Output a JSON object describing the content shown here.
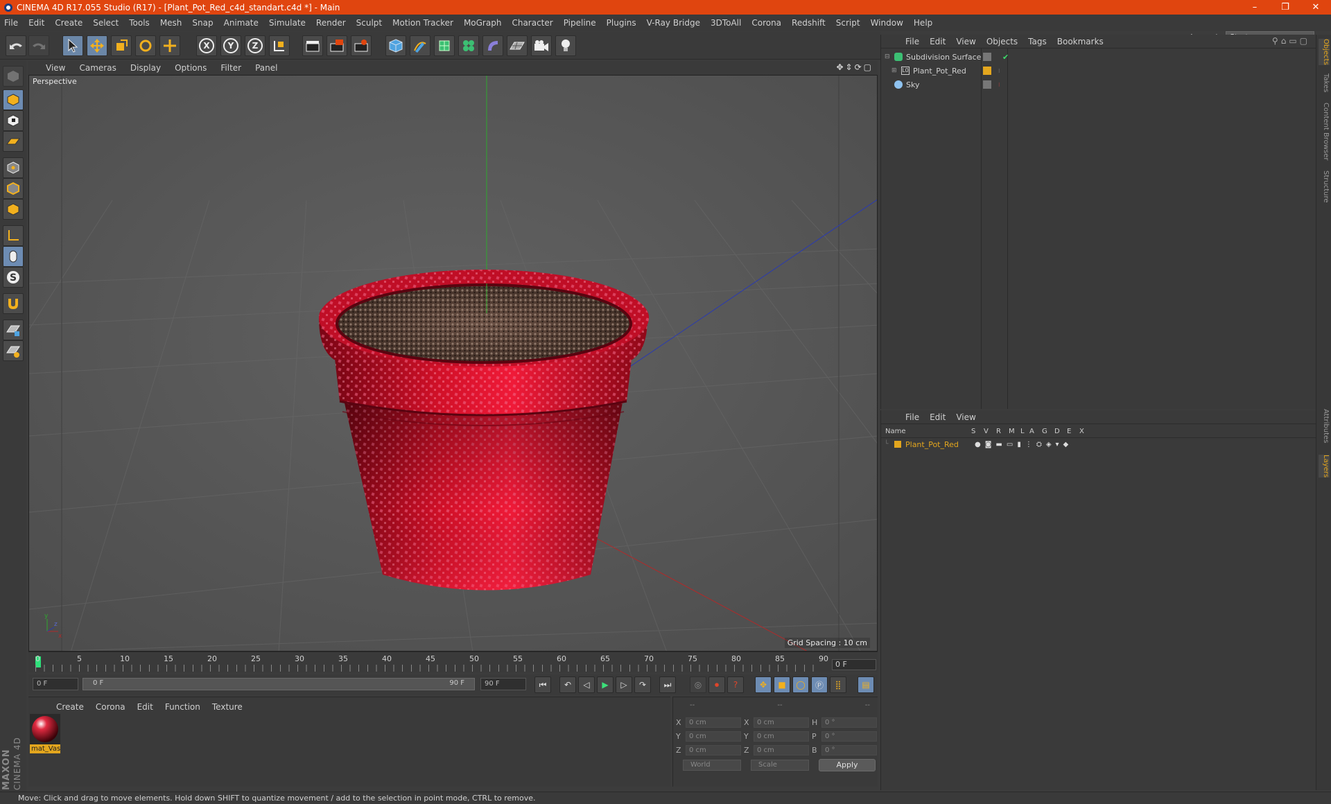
{
  "window": {
    "title": "CINEMA 4D R17.055 Studio (R17) - [Plant_Pot_Red_c4d_standart.c4d *] - Main",
    "controls": [
      "–",
      "❐",
      "✕"
    ]
  },
  "menubar": [
    "File",
    "Edit",
    "Create",
    "Select",
    "Tools",
    "Mesh",
    "Snap",
    "Animate",
    "Simulate",
    "Render",
    "Sculpt",
    "Motion Tracker",
    "MoGraph",
    "Character",
    "Pipeline",
    "Plugins",
    "V-Ray Bridge",
    "3DToAll",
    "Corona",
    "Redshift",
    "Script",
    "Window",
    "Help"
  ],
  "layout": {
    "label": "Layout:",
    "value": "Startup"
  },
  "toolbar": {
    "axis_x": "X",
    "axis_y": "Y",
    "axis_z": "Z"
  },
  "viewport": {
    "menu": [
      "View",
      "Cameras",
      "Display",
      "Options",
      "Filter",
      "Panel"
    ],
    "label": "Perspective",
    "grid_spacing": "Grid Spacing : 10 cm"
  },
  "timeline": {
    "ticks": [
      "0",
      "5",
      "10",
      "15",
      "20",
      "25",
      "30",
      "35",
      "40",
      "45",
      "50",
      "55",
      "60",
      "65",
      "70",
      "75",
      "80",
      "85",
      "90"
    ],
    "current_frame": "0 F"
  },
  "transport": {
    "start": "0 F",
    "range_start": "0 F",
    "range_end": "90 F",
    "end": "90 F"
  },
  "materials": {
    "menu": [
      "Create",
      "Corona",
      "Edit",
      "Function",
      "Texture"
    ],
    "items": [
      {
        "name": "mat_Vas"
      }
    ]
  },
  "coordinates": {
    "header": [
      "--",
      "--",
      "--"
    ],
    "rows": [
      {
        "l1": "X",
        "v1": "0 cm",
        "l2": "X",
        "v2": "0 cm",
        "l3": "H",
        "v3": "0 °"
      },
      {
        "l1": "Y",
        "v1": "0 cm",
        "l2": "Y",
        "v2": "0 cm",
        "l3": "P",
        "v3": "0 °"
      },
      {
        "l1": "Z",
        "v1": "0 cm",
        "l2": "Z",
        "v2": "0 cm",
        "l3": "B",
        "v3": "0 °"
      }
    ],
    "world": "World",
    "scale": "Scale",
    "apply": "Apply"
  },
  "status": "Move: Click and drag to move elements. Hold down SHIFT to quantize movement / add to the selection in point mode, CTRL to remove.",
  "objects_panel": {
    "menu": [
      "File",
      "Edit",
      "View",
      "Objects",
      "Tags",
      "Bookmarks"
    ],
    "objects": [
      {
        "name": "Subdivision Surface"
      },
      {
        "name": "Plant_Pot_Red"
      },
      {
        "name": "Sky"
      }
    ]
  },
  "layers_panel": {
    "menu": [
      "File",
      "Edit",
      "View"
    ],
    "columns": [
      "Name",
      "S",
      "V",
      "R",
      "M",
      "L",
      "A",
      "G",
      "D",
      "E",
      "X"
    ],
    "layers": [
      {
        "name": "Plant_Pot_Red"
      }
    ]
  },
  "side_tabs": [
    "Objects",
    "Takes",
    "Content Browser",
    "Structure",
    "Attributes",
    "Layers"
  ],
  "logo": {
    "maxon": "MAXON",
    "product": "CINEMA 4D"
  },
  "colors": {
    "accent": "#e0450f",
    "selection": "#e3a61e",
    "pot_red": "#d4102a"
  }
}
